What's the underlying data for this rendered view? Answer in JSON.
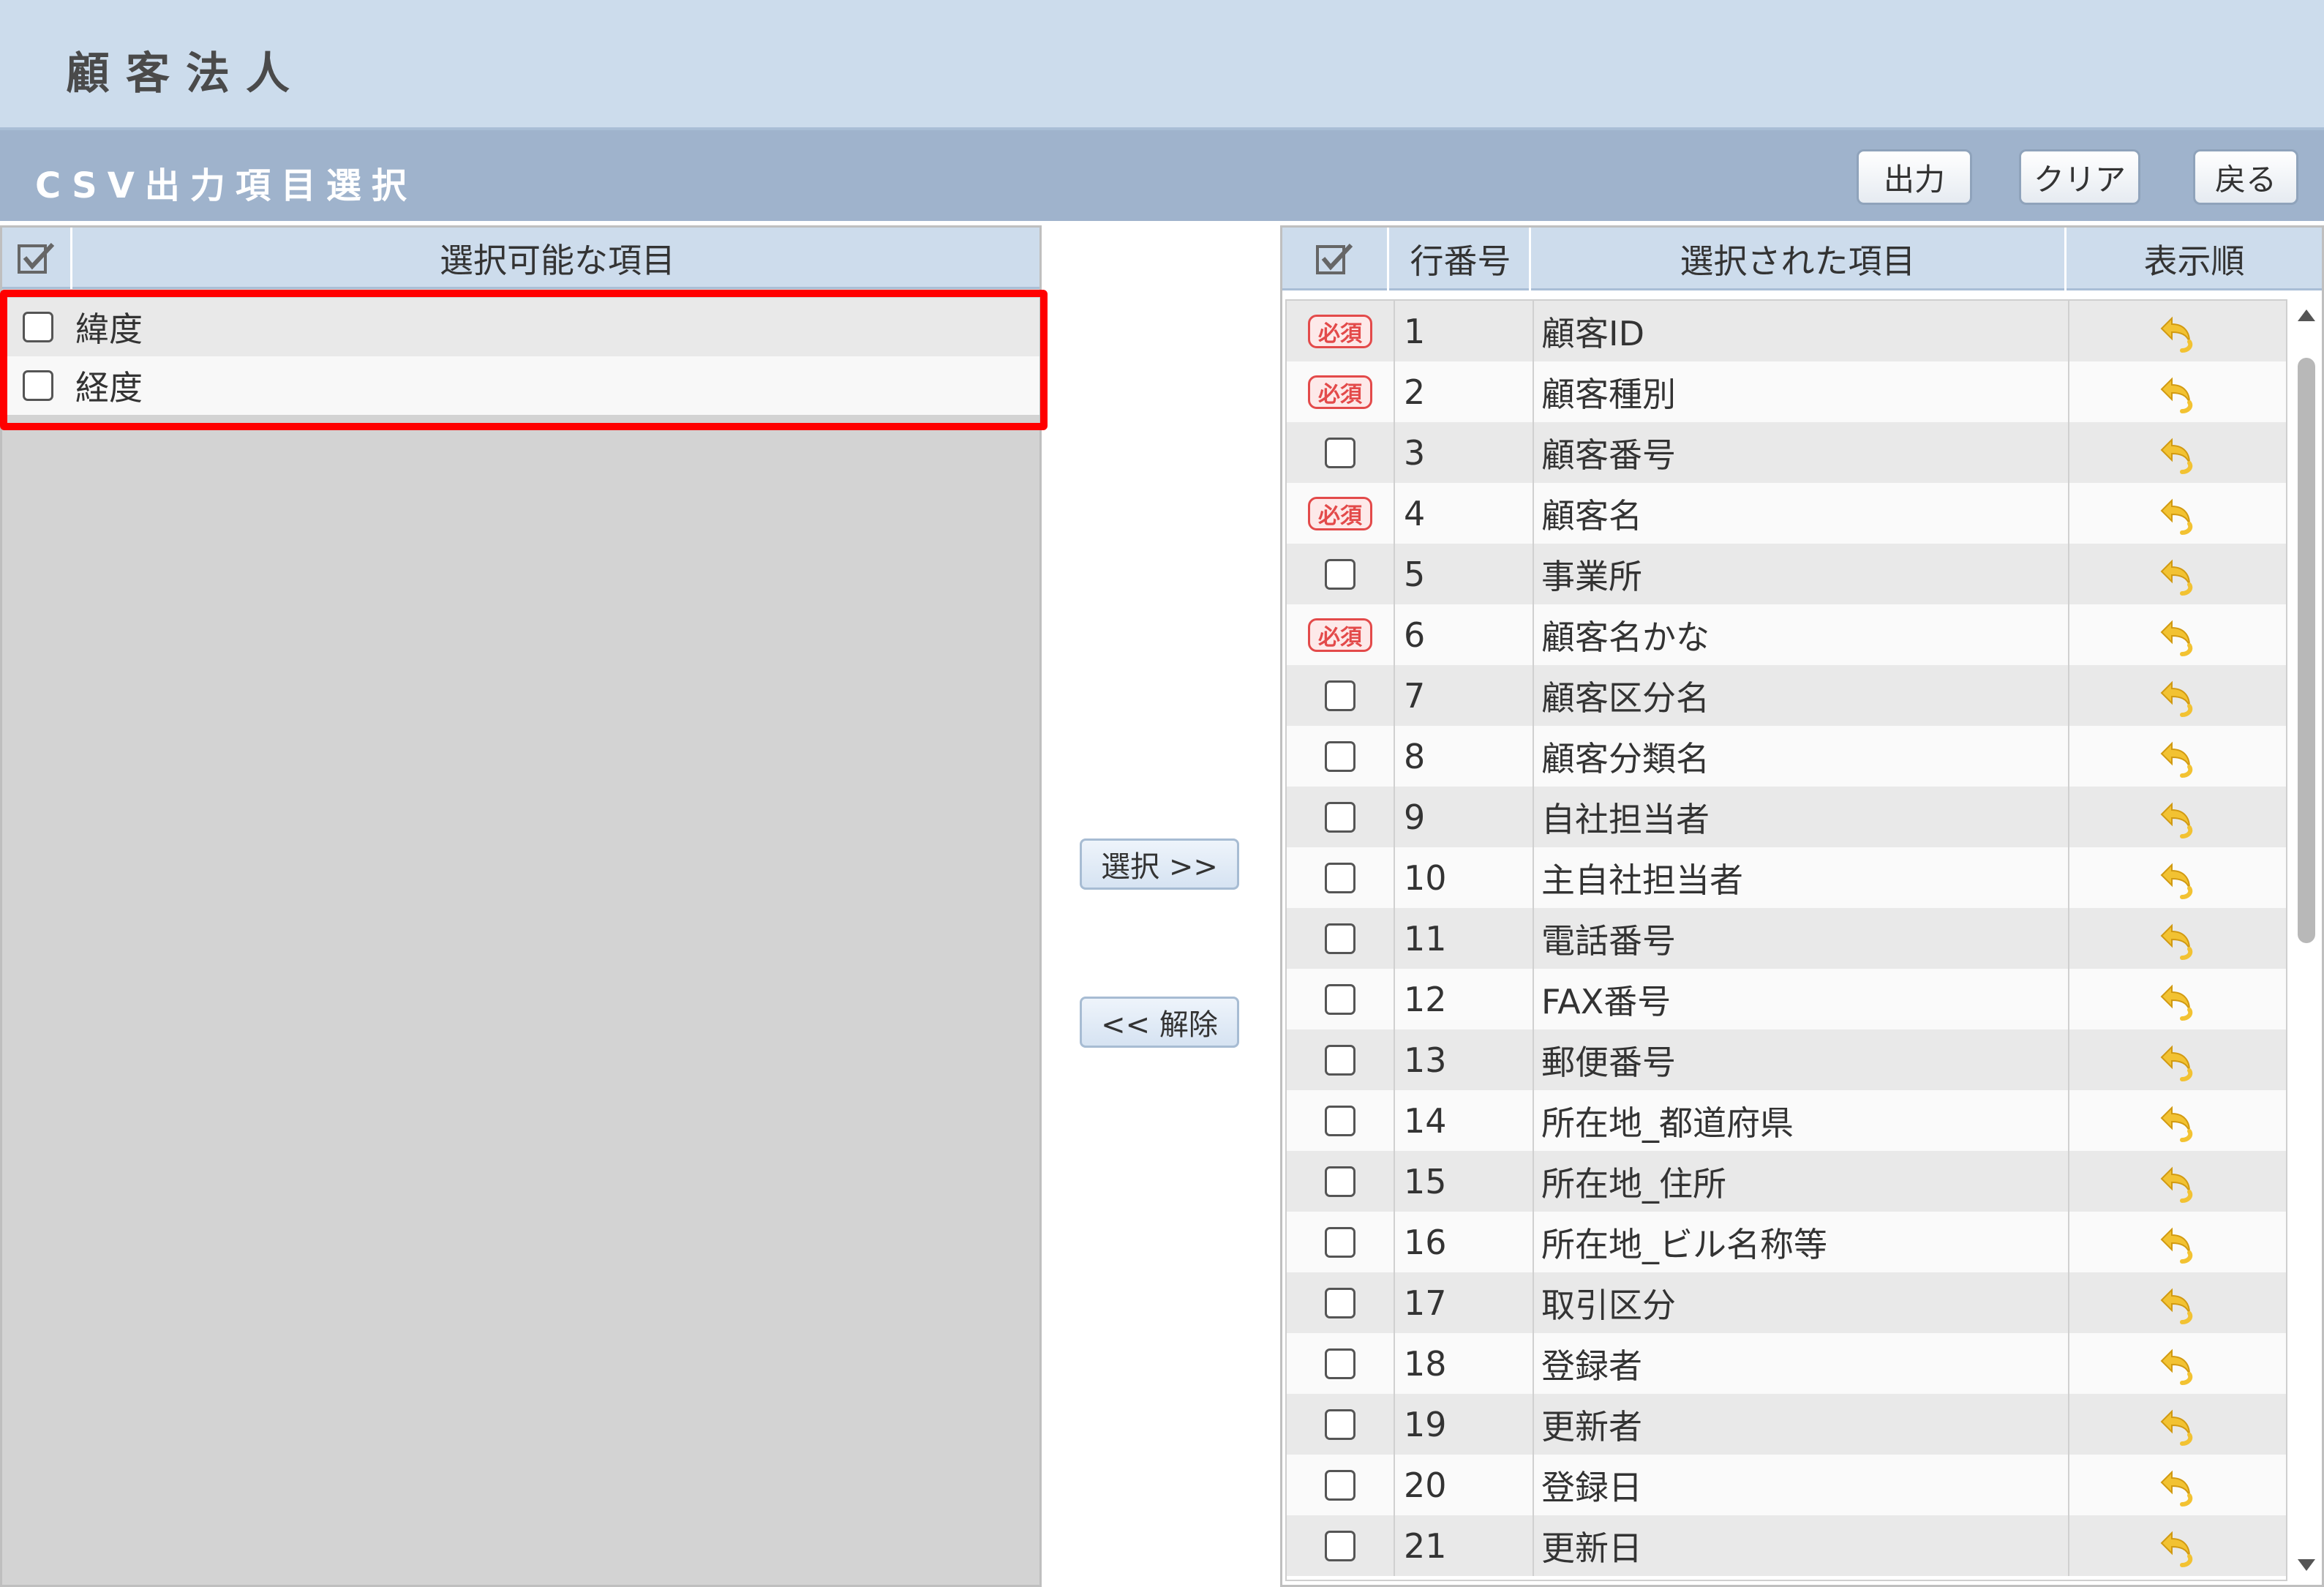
{
  "window": {
    "title": "顧客法人"
  },
  "section": {
    "title": "CSV出力項目選択",
    "buttons": {
      "output": "出力",
      "clear": "クリア",
      "back": "戻る"
    }
  },
  "available": {
    "header": "選択可能な項目",
    "items": [
      "緯度",
      "経度"
    ]
  },
  "controls": {
    "select": "選択 >>",
    "release": "<< 解除"
  },
  "selected": {
    "headers": {
      "row_no": "行番号",
      "item": "選択された項目",
      "order": "表示順"
    },
    "required_label": "必須",
    "rows": [
      {
        "no": "1",
        "name": "顧客ID",
        "required": true
      },
      {
        "no": "2",
        "name": "顧客種別",
        "required": true
      },
      {
        "no": "3",
        "name": "顧客番号",
        "required": false
      },
      {
        "no": "4",
        "name": "顧客名",
        "required": true
      },
      {
        "no": "5",
        "name": "事業所",
        "required": false
      },
      {
        "no": "6",
        "name": "顧客名かな",
        "required": true
      },
      {
        "no": "7",
        "name": "顧客区分名",
        "required": false
      },
      {
        "no": "8",
        "name": "顧客分類名",
        "required": false
      },
      {
        "no": "9",
        "name": "自社担当者",
        "required": false
      },
      {
        "no": "10",
        "name": "主自社担当者",
        "required": false
      },
      {
        "no": "11",
        "name": "電話番号",
        "required": false
      },
      {
        "no": "12",
        "name": "FAX番号",
        "required": false
      },
      {
        "no": "13",
        "name": "郵便番号",
        "required": false
      },
      {
        "no": "14",
        "name": "所在地_都道府県",
        "required": false
      },
      {
        "no": "15",
        "name": "所在地_住所",
        "required": false
      },
      {
        "no": "16",
        "name": "所在地_ビル名称等",
        "required": false
      },
      {
        "no": "17",
        "name": "取引区分",
        "required": false
      },
      {
        "no": "18",
        "name": "登録者",
        "required": false
      },
      {
        "no": "19",
        "name": "更新者",
        "required": false
      },
      {
        "no": "20",
        "name": "登録日",
        "required": false
      },
      {
        "no": "21",
        "name": "更新日",
        "required": false
      }
    ]
  },
  "colors": {
    "title_bg": "#ccdcec",
    "section_bg": "#9fb3cc",
    "required_red": "#e34a4a",
    "highlight": "#ff0000",
    "order_icon": "#f2c232"
  },
  "icons": {
    "check_all": "checkmark-box-icon",
    "order": "undo-arrow-icon"
  }
}
